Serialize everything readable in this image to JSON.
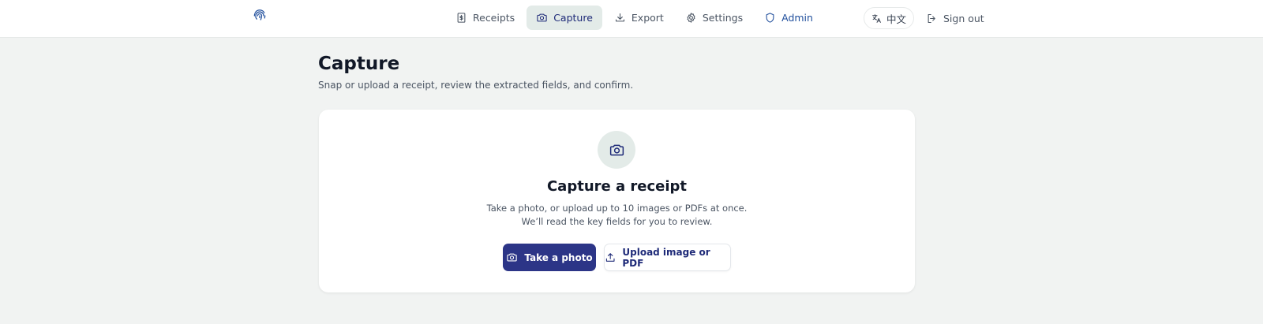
{
  "header": {
    "logo_icon": "fingerprint-icon",
    "nav": [
      {
        "label": "Receipts",
        "icon": "receipt-icon"
      },
      {
        "label": "Capture",
        "icon": "camera-icon",
        "active": true
      },
      {
        "label": "Export",
        "icon": "download-icon"
      },
      {
        "label": "Settings",
        "icon": "gear-icon"
      },
      {
        "label": "Admin",
        "icon": "shield-icon"
      }
    ],
    "language_label": "中文",
    "sign_out_label": "Sign out"
  },
  "page": {
    "title": "Capture",
    "subtitle": "Snap or upload a receipt, review the extracted fields, and confirm."
  },
  "card": {
    "title": "Capture a receipt",
    "description_line1": "Take a photo, or upload up to 10 images or PDFs at once.",
    "description_line2": "We’ll read the key fields for you to review.",
    "take_photo_label": "Take a photo",
    "upload_label": "Upload image or PDF"
  },
  "colors": {
    "accent": "#2c3587",
    "active_nav_bg": "#e3ebe8",
    "admin_link": "#1f4e9c",
    "page_bg": "#f1f3f2"
  }
}
